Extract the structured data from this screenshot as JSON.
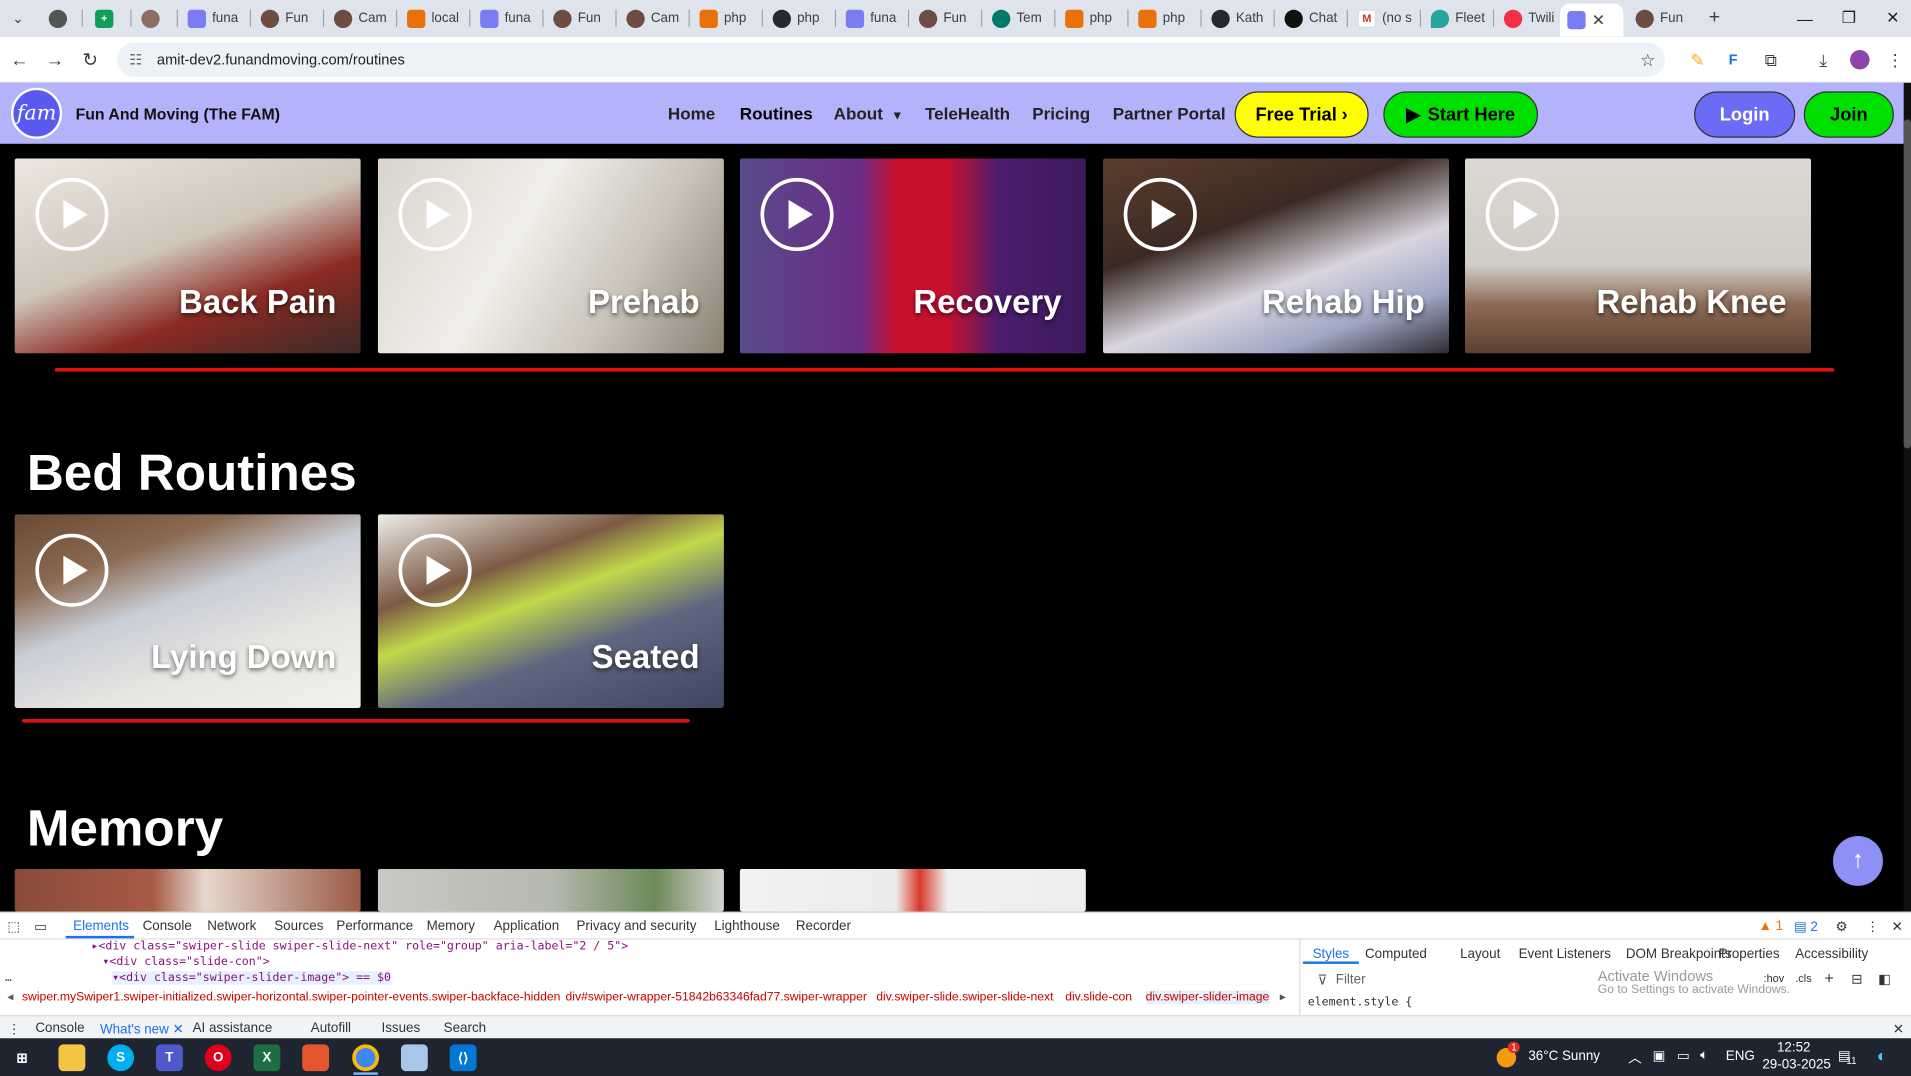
{
  "browser": {
    "tabs": [
      {
        "label": "",
        "favicon": "tab-list-icon"
      },
      {
        "label": "",
        "favicon": "globe-icon"
      },
      {
        "label": "",
        "favicon": "sheets-icon"
      },
      {
        "label": "",
        "favicon": "profile-icon"
      },
      {
        "label": "funa",
        "favicon": "fam-icon"
      },
      {
        "label": "Fun",
        "favicon": "profile-icon"
      },
      {
        "label": "Cam",
        "favicon": "profile-icon"
      },
      {
        "label": "local",
        "favicon": "phpmyadmin-icon"
      },
      {
        "label": "funa",
        "favicon": "fam-icon"
      },
      {
        "label": "Fun",
        "favicon": "profile-icon"
      },
      {
        "label": "Cam",
        "favicon": "profile-icon"
      },
      {
        "label": "php",
        "favicon": "phpmyadmin-icon"
      },
      {
        "label": "php",
        "favicon": "github-icon"
      },
      {
        "label": "funa",
        "favicon": "fam-icon"
      },
      {
        "label": "Fun",
        "favicon": "profile-icon"
      },
      {
        "label": "Tem",
        "favicon": "globe-icon"
      },
      {
        "label": "php",
        "favicon": "phpmyadmin-icon"
      },
      {
        "label": "php",
        "favicon": "phpmyadmin-icon"
      },
      {
        "label": "Kath",
        "favicon": "github-icon"
      },
      {
        "label": "Chat",
        "favicon": "openai-icon"
      },
      {
        "label": "(no s",
        "favicon": "gmail-icon"
      },
      {
        "label": "Fleet",
        "favicon": "map-pin-icon"
      },
      {
        "label": "Twili",
        "favicon": "twilio-icon"
      },
      {
        "label": "",
        "favicon": "fam-icon"
      },
      {
        "label": "Fun",
        "favicon": "profile-icon"
      }
    ],
    "new_tab": "+",
    "url": "amit-dev2.funandmoving.com/routines"
  },
  "site": {
    "brand": "Fun And Moving (The FAM)",
    "logo_text": "fam",
    "nav": {
      "home": "Home",
      "routines": "Routines",
      "about": "About",
      "telehealth": "TeleHealth",
      "pricing": "Pricing",
      "partner": "Partner Portal"
    },
    "free_trial": "Free Trial",
    "start_here": "Start Here",
    "login": "Login",
    "join": "Join",
    "colors": {
      "header": "#b3b3fb",
      "free_trial": "#ffff00",
      "start_here": "#00e000",
      "login": "#6b6bf5",
      "join": "#00e000",
      "underline": "#e01010"
    }
  },
  "sections": {
    "top_row": [
      "Back Pain",
      "Prehab",
      "Recovery",
      "Rehab Hip",
      "Rehab Knee"
    ],
    "bed_title": "Bed Routines",
    "bed_row": [
      "Lying Down",
      "Seated"
    ],
    "memory_title": "Memory"
  },
  "devtools": {
    "tabs": [
      "Elements",
      "Console",
      "Network",
      "Sources",
      "Performance",
      "Memory",
      "Application",
      "Privacy and security",
      "Lighthouse",
      "Recorder"
    ],
    "warnings": "1",
    "messages": "2",
    "code": [
      "<div class=\"swiper-slide swiper-slide-next\" role=\"group\" aria-label=\"2 / 5\">",
      "<div class=\"slide-con\">",
      "<div class=\"swiper-slider-image\"> == $0"
    ],
    "crumbs": [
      "swiper.mySwiper1.swiper-initialized.swiper-horizontal.swiper-pointer-events.swiper-backface-hidden",
      "div#swiper-wrapper-51842b63346fad77.swiper-wrapper",
      "div.swiper-slide.swiper-slide-next",
      "div.slide-con",
      "div.swiper-slider-image"
    ],
    "side_tabs": [
      "Styles",
      "Computed",
      "Layout",
      "Event Listeners",
      "DOM Breakpoints",
      "Properties",
      "Accessibility"
    ],
    "filter_placeholder": "Filter",
    "hov": ":hov",
    "cls": ".cls",
    "element_style": "element.style {",
    "activate_1": "Activate Windows",
    "activate_2": "Go to Settings to activate Windows.",
    "drawer_tabs": [
      "Console",
      "What's new",
      "AI assistance",
      "Autofill",
      "Issues",
      "Search"
    ]
  },
  "taskbar": {
    "weather": "36°C  Sunny",
    "lang": "ENG",
    "time": "12:52",
    "date": "29-03-2025",
    "notif": "11",
    "weather_badge": "1"
  }
}
